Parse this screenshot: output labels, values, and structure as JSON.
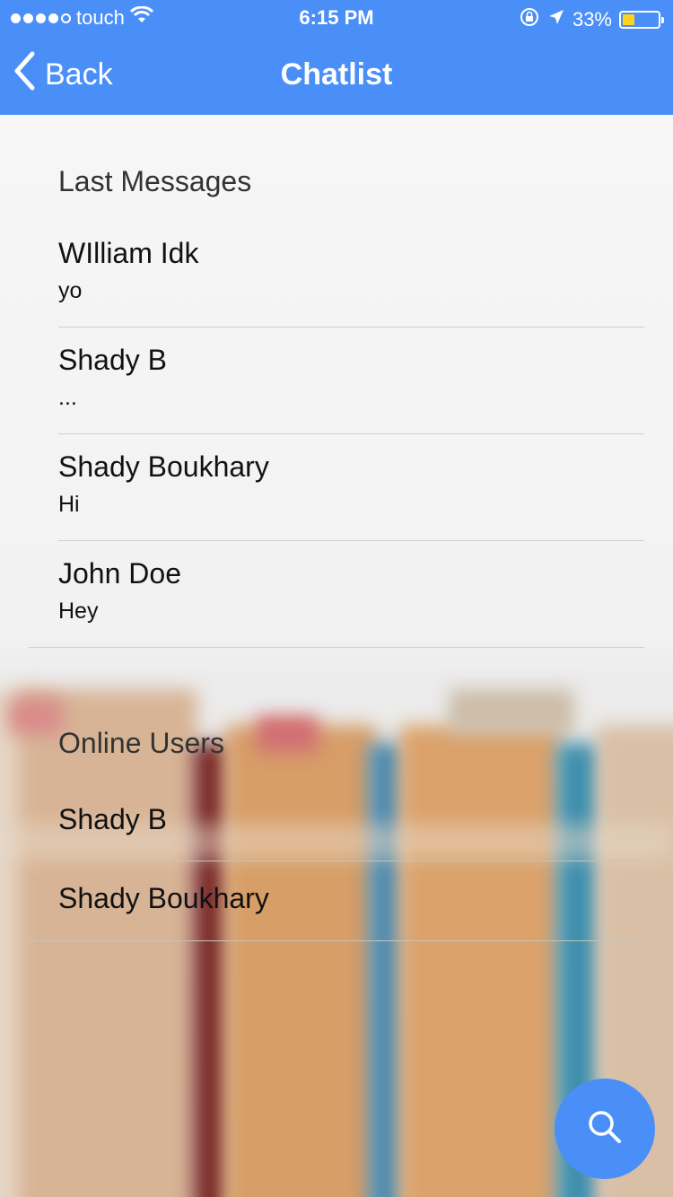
{
  "status_bar": {
    "carrier": "touch",
    "time": "6:15 PM",
    "battery": "33%",
    "battery_level": 0.33
  },
  "nav": {
    "back_label": "Back",
    "title": "Chatlist"
  },
  "last_messages": {
    "title": "Last Messages",
    "items": [
      {
        "name": "WIlliam Idk",
        "message": "yo"
      },
      {
        "name": "Shady B",
        "message": "..."
      },
      {
        "name": "Shady Boukhary",
        "message": "Hi"
      },
      {
        "name": "John Doe",
        "message": "Hey"
      }
    ]
  },
  "online_users": {
    "title": "Online Users",
    "items": [
      {
        "name": "Shady B"
      },
      {
        "name": "Shady Boukhary"
      }
    ]
  },
  "fab": {
    "icon": "search-icon"
  },
  "colors": {
    "accent": "#4a8ff8",
    "battery": "#ffd21f"
  }
}
